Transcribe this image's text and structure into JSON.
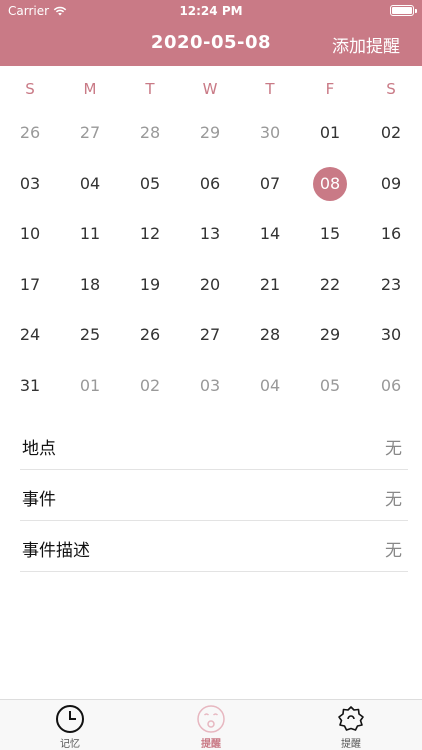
{
  "status_bar": {
    "carrier": "Carrier",
    "time": "12:24 PM"
  },
  "nav": {
    "title": "2020-05-08",
    "action": "添加提醒"
  },
  "calendar": {
    "weekdays": [
      "S",
      "M",
      "T",
      "W",
      "T",
      "F",
      "S"
    ],
    "weeks": [
      [
        {
          "d": "26",
          "out": true
        },
        {
          "d": "27",
          "out": true
        },
        {
          "d": "28",
          "out": true
        },
        {
          "d": "29",
          "out": true
        },
        {
          "d": "30",
          "out": true
        },
        {
          "d": "01",
          "out": false
        },
        {
          "d": "02",
          "out": false
        }
      ],
      [
        {
          "d": "03",
          "out": false
        },
        {
          "d": "04",
          "out": false
        },
        {
          "d": "05",
          "out": false
        },
        {
          "d": "06",
          "out": false
        },
        {
          "d": "07",
          "out": false
        },
        {
          "d": "08",
          "out": false,
          "selected": true
        },
        {
          "d": "09",
          "out": false
        }
      ],
      [
        {
          "d": "10",
          "out": false
        },
        {
          "d": "11",
          "out": false
        },
        {
          "d": "12",
          "out": false
        },
        {
          "d": "13",
          "out": false
        },
        {
          "d": "14",
          "out": false
        },
        {
          "d": "15",
          "out": false
        },
        {
          "d": "16",
          "out": false
        }
      ],
      [
        {
          "d": "17",
          "out": false
        },
        {
          "d": "18",
          "out": false
        },
        {
          "d": "19",
          "out": false
        },
        {
          "d": "20",
          "out": false
        },
        {
          "d": "21",
          "out": false
        },
        {
          "d": "22",
          "out": false
        },
        {
          "d": "23",
          "out": false
        }
      ],
      [
        {
          "d": "24",
          "out": false
        },
        {
          "d": "25",
          "out": false
        },
        {
          "d": "26",
          "out": false
        },
        {
          "d": "27",
          "out": false
        },
        {
          "d": "28",
          "out": false
        },
        {
          "d": "29",
          "out": false
        },
        {
          "d": "30",
          "out": false
        }
      ],
      [
        {
          "d": "31",
          "out": false
        },
        {
          "d": "01",
          "out": true
        },
        {
          "d": "02",
          "out": true
        },
        {
          "d": "03",
          "out": true
        },
        {
          "d": "04",
          "out": true
        },
        {
          "d": "05",
          "out": true
        },
        {
          "d": "06",
          "out": true
        }
      ]
    ]
  },
  "details": [
    {
      "label": "地点",
      "value": "无"
    },
    {
      "label": "事件",
      "value": "无"
    },
    {
      "label": "事件描述",
      "value": "无"
    }
  ],
  "tabs": [
    {
      "label": "记忆",
      "icon": "clock-icon",
      "active": false
    },
    {
      "label": "提醒",
      "icon": "smiley-face-icon",
      "active": true
    },
    {
      "label": "提醒",
      "icon": "gear-icon",
      "active": false
    }
  ],
  "colors": {
    "accent": "#c97a86",
    "header_bg": "#c97a86",
    "muted_text": "#999999"
  }
}
